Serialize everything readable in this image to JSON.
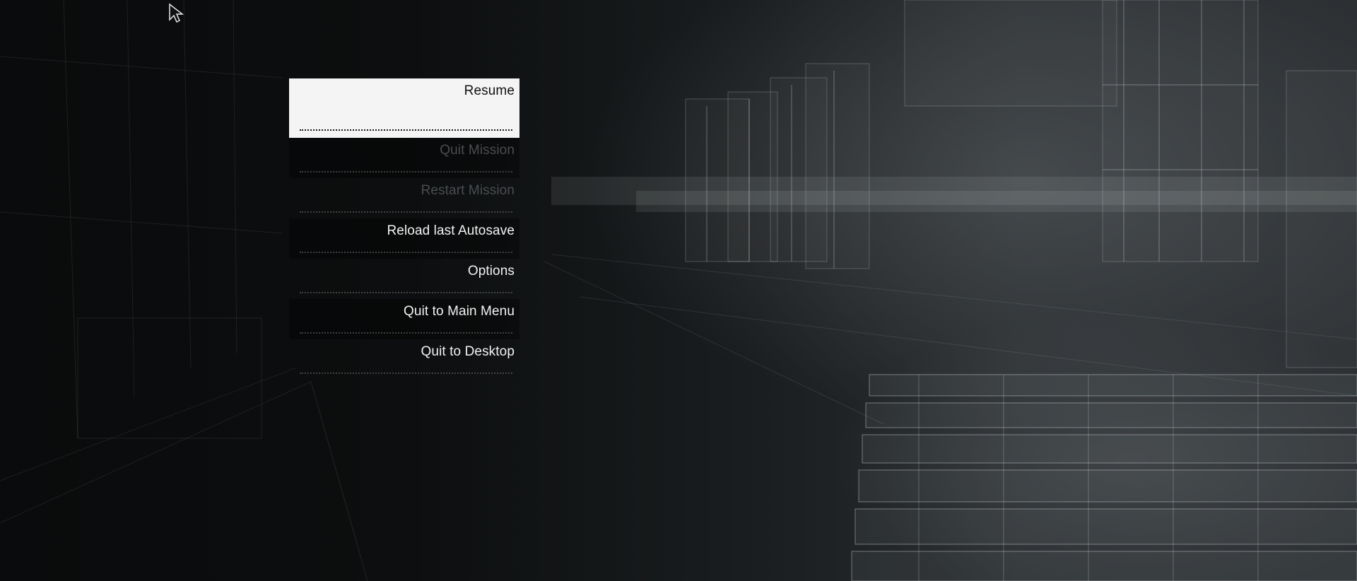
{
  "menu": {
    "items": [
      {
        "label": "Resume",
        "state": "selected"
      },
      {
        "label": "Quit Mission",
        "state": "disabled"
      },
      {
        "label": "Restart Mission",
        "state": "disabled"
      },
      {
        "label": "Reload last Autosave",
        "state": "enabled"
      },
      {
        "label": "Options",
        "state": "enabled"
      },
      {
        "label": "Quit to Main Menu",
        "state": "enabled"
      },
      {
        "label": "Quit to Desktop",
        "state": "enabled"
      }
    ]
  },
  "colors": {
    "selected_bg": "#f4f4f4",
    "selected_text": "#111111",
    "enabled_text": "#f2f2f2",
    "disabled_text": "#4a4d50"
  },
  "icons": {
    "cursor": "mouse-pointer-icon"
  }
}
